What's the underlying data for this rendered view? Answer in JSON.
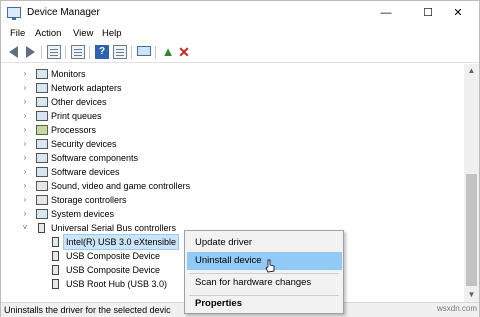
{
  "window": {
    "title": "Device Manager",
    "controls": {
      "minimize": "—",
      "maximize": "☐",
      "close": "✕"
    }
  },
  "menu": [
    "File",
    "Action",
    "View",
    "Help"
  ],
  "toolbar": {
    "help_glyph": "?",
    "enable_glyph": "▲",
    "uninstall_glyph": "✕"
  },
  "tree": {
    "categories": [
      {
        "label": "Monitors",
        "icon": "monitor-icon"
      },
      {
        "label": "Network adapters",
        "icon": "network-icon"
      },
      {
        "label": "Other devices",
        "icon": "other-devices-icon"
      },
      {
        "label": "Print queues",
        "icon": "printer-icon"
      },
      {
        "label": "Processors",
        "icon": "processor-icon"
      },
      {
        "label": "Security devices",
        "icon": "security-icon"
      },
      {
        "label": "Software components",
        "icon": "software-components-icon"
      },
      {
        "label": "Software devices",
        "icon": "software-devices-icon"
      },
      {
        "label": "Sound, video and game controllers",
        "icon": "speaker-icon"
      },
      {
        "label": "Storage controllers",
        "icon": "storage-icon"
      },
      {
        "label": "System devices",
        "icon": "system-icon"
      },
      {
        "label": "Universal Serial Bus controllers",
        "icon": "usb-icon"
      }
    ],
    "usb_children": [
      {
        "label": "Intel(R) USB 3.0 eXtensible",
        "selected": true
      },
      {
        "label": "USB Composite Device",
        "selected": false
      },
      {
        "label": "USB Composite Device",
        "selected": false
      },
      {
        "label": "USB Root Hub (USB 3.0)",
        "selected": false
      }
    ],
    "chevron_collapsed": "›",
    "chevron_expanded": "˅"
  },
  "context_menu": {
    "items": [
      "Update driver",
      "Uninstall device",
      "Scan for hardware changes",
      "Properties"
    ],
    "highlighted": "Uninstall device",
    "highlight_color": "#91c9f7"
  },
  "statusbar": {
    "text": "Uninstalls the driver for the selected devic"
  },
  "watermark": "wsxdn.com"
}
